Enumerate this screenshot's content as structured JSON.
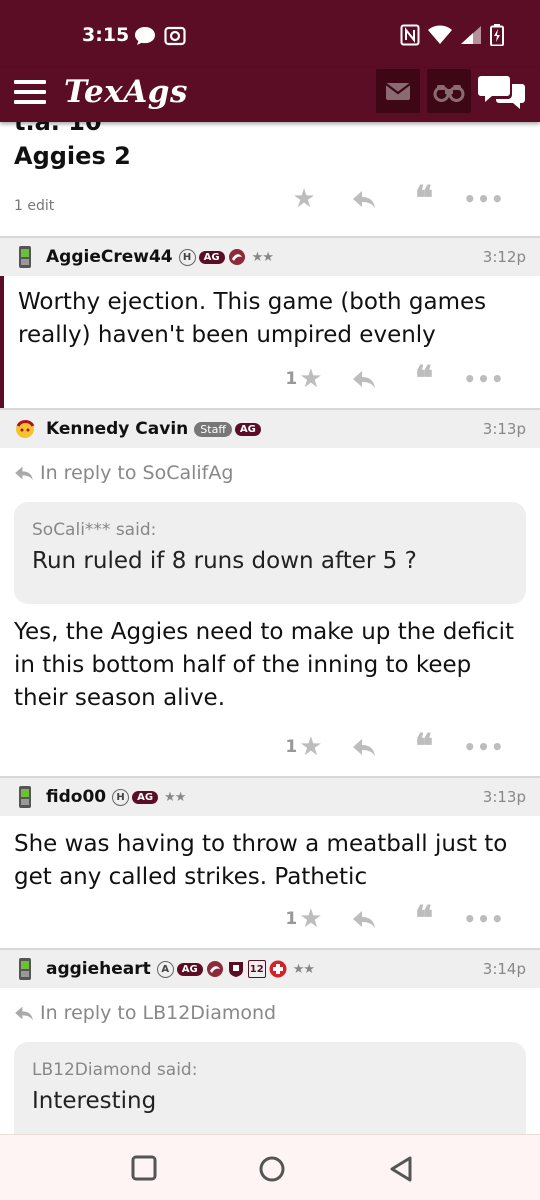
{
  "status_bar": {
    "time": "3:15"
  },
  "app_bar": {
    "logo": "TexAgs"
  },
  "previous_post": {
    "cut_line": "t.a. 10",
    "last_line": "Aggies 2",
    "edit_note": "1 edit"
  },
  "posts": [
    {
      "username": "AggieCrew44",
      "time": "3:12p",
      "text": "Worthy ejection. This game (both games really) haven't been umpired evenly",
      "likes": "1"
    },
    {
      "username": "Kennedy Cavin",
      "staff_label": "Staff",
      "time": "3:13p",
      "reply_to": "In reply to SoCalifAg",
      "quote_author": "SoCali*** said:",
      "quote_text": "Run ruled if 8 runs down after 5 ?",
      "text": "Yes, the Aggies need to make up the deficit in this bottom half of the inning to keep their season alive.",
      "likes": "1"
    },
    {
      "username": "fido00",
      "time": "3:13p",
      "text": "She was having to throw a meatball just to get any called strikes. Pathetic",
      "likes": "1"
    },
    {
      "username": "aggieheart",
      "time": "3:14p",
      "reply_to": "In reply to LB12Diamond",
      "quote_author": "LB12Diamond said:",
      "quote_text": "Interesting"
    }
  ],
  "badges": {
    "h": "H",
    "a": "A",
    "ag": "AG",
    "stars": "★★",
    "twelve": "12"
  },
  "colors": {
    "maroon": "#5b0d25",
    "dark_maroon": "#3d0715"
  }
}
